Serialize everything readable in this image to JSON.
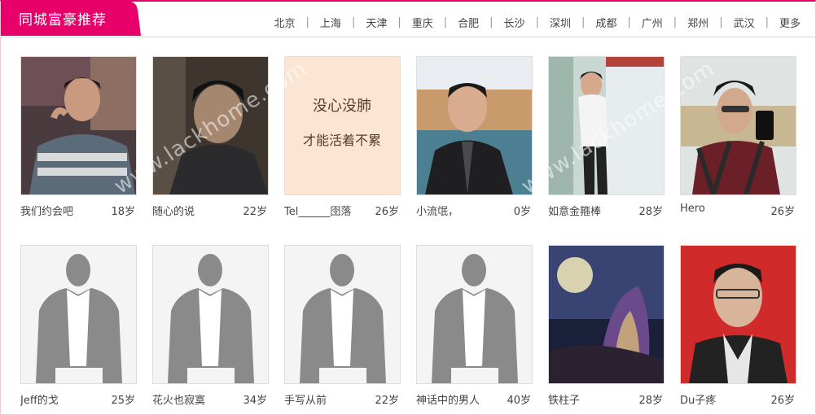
{
  "header": {
    "title": "同城富豪推荐",
    "cities": [
      "北京",
      "上海",
      "天津",
      "重庆",
      "合肥",
      "长沙",
      "深圳",
      "成都",
      "广州",
      "郑州",
      "武汉",
      "更多"
    ],
    "separator": "|"
  },
  "users": [
    {
      "name": "我们约会吧",
      "age": "18岁",
      "photo": "photo-man-1"
    },
    {
      "name": "随心的说",
      "age": "22岁",
      "photo": "photo-man-2"
    },
    {
      "name": "Tel______囹落",
      "age": "26岁",
      "photo": "photo-text-card",
      "photo_text_1": "没心没肺",
      "photo_text_2": "才能活着不累"
    },
    {
      "name": "小流氓，",
      "age": "0岁",
      "photo": "photo-man-3"
    },
    {
      "name": "如意金箍棒",
      "age": "28岁",
      "photo": "photo-man-4"
    },
    {
      "name": "Hero",
      "age": "26岁",
      "photo": "photo-man-5"
    },
    {
      "name": "Jeff的戈",
      "age": "25岁",
      "photo": "placeholder-silhouette"
    },
    {
      "name": "花火也寂寞",
      "age": "34岁",
      "photo": "placeholder-silhouette"
    },
    {
      "name": "手写从前",
      "age": "22岁",
      "photo": "placeholder-silhouette"
    },
    {
      "name": "神话中的男人",
      "age": "40岁",
      "photo": "placeholder-silhouette"
    },
    {
      "name": "铁柱子",
      "age": "28岁",
      "photo": "photo-fantasy-art"
    },
    {
      "name": "Du子疼",
      "age": "26岁",
      "photo": "photo-man-6"
    }
  ],
  "watermark": "www.lackhome.com",
  "colors": {
    "accent": "#e8006a",
    "border": "#f0c9d8",
    "placeholder_bg": "#f4f4f4",
    "silhouette": "#8a8a8a"
  }
}
